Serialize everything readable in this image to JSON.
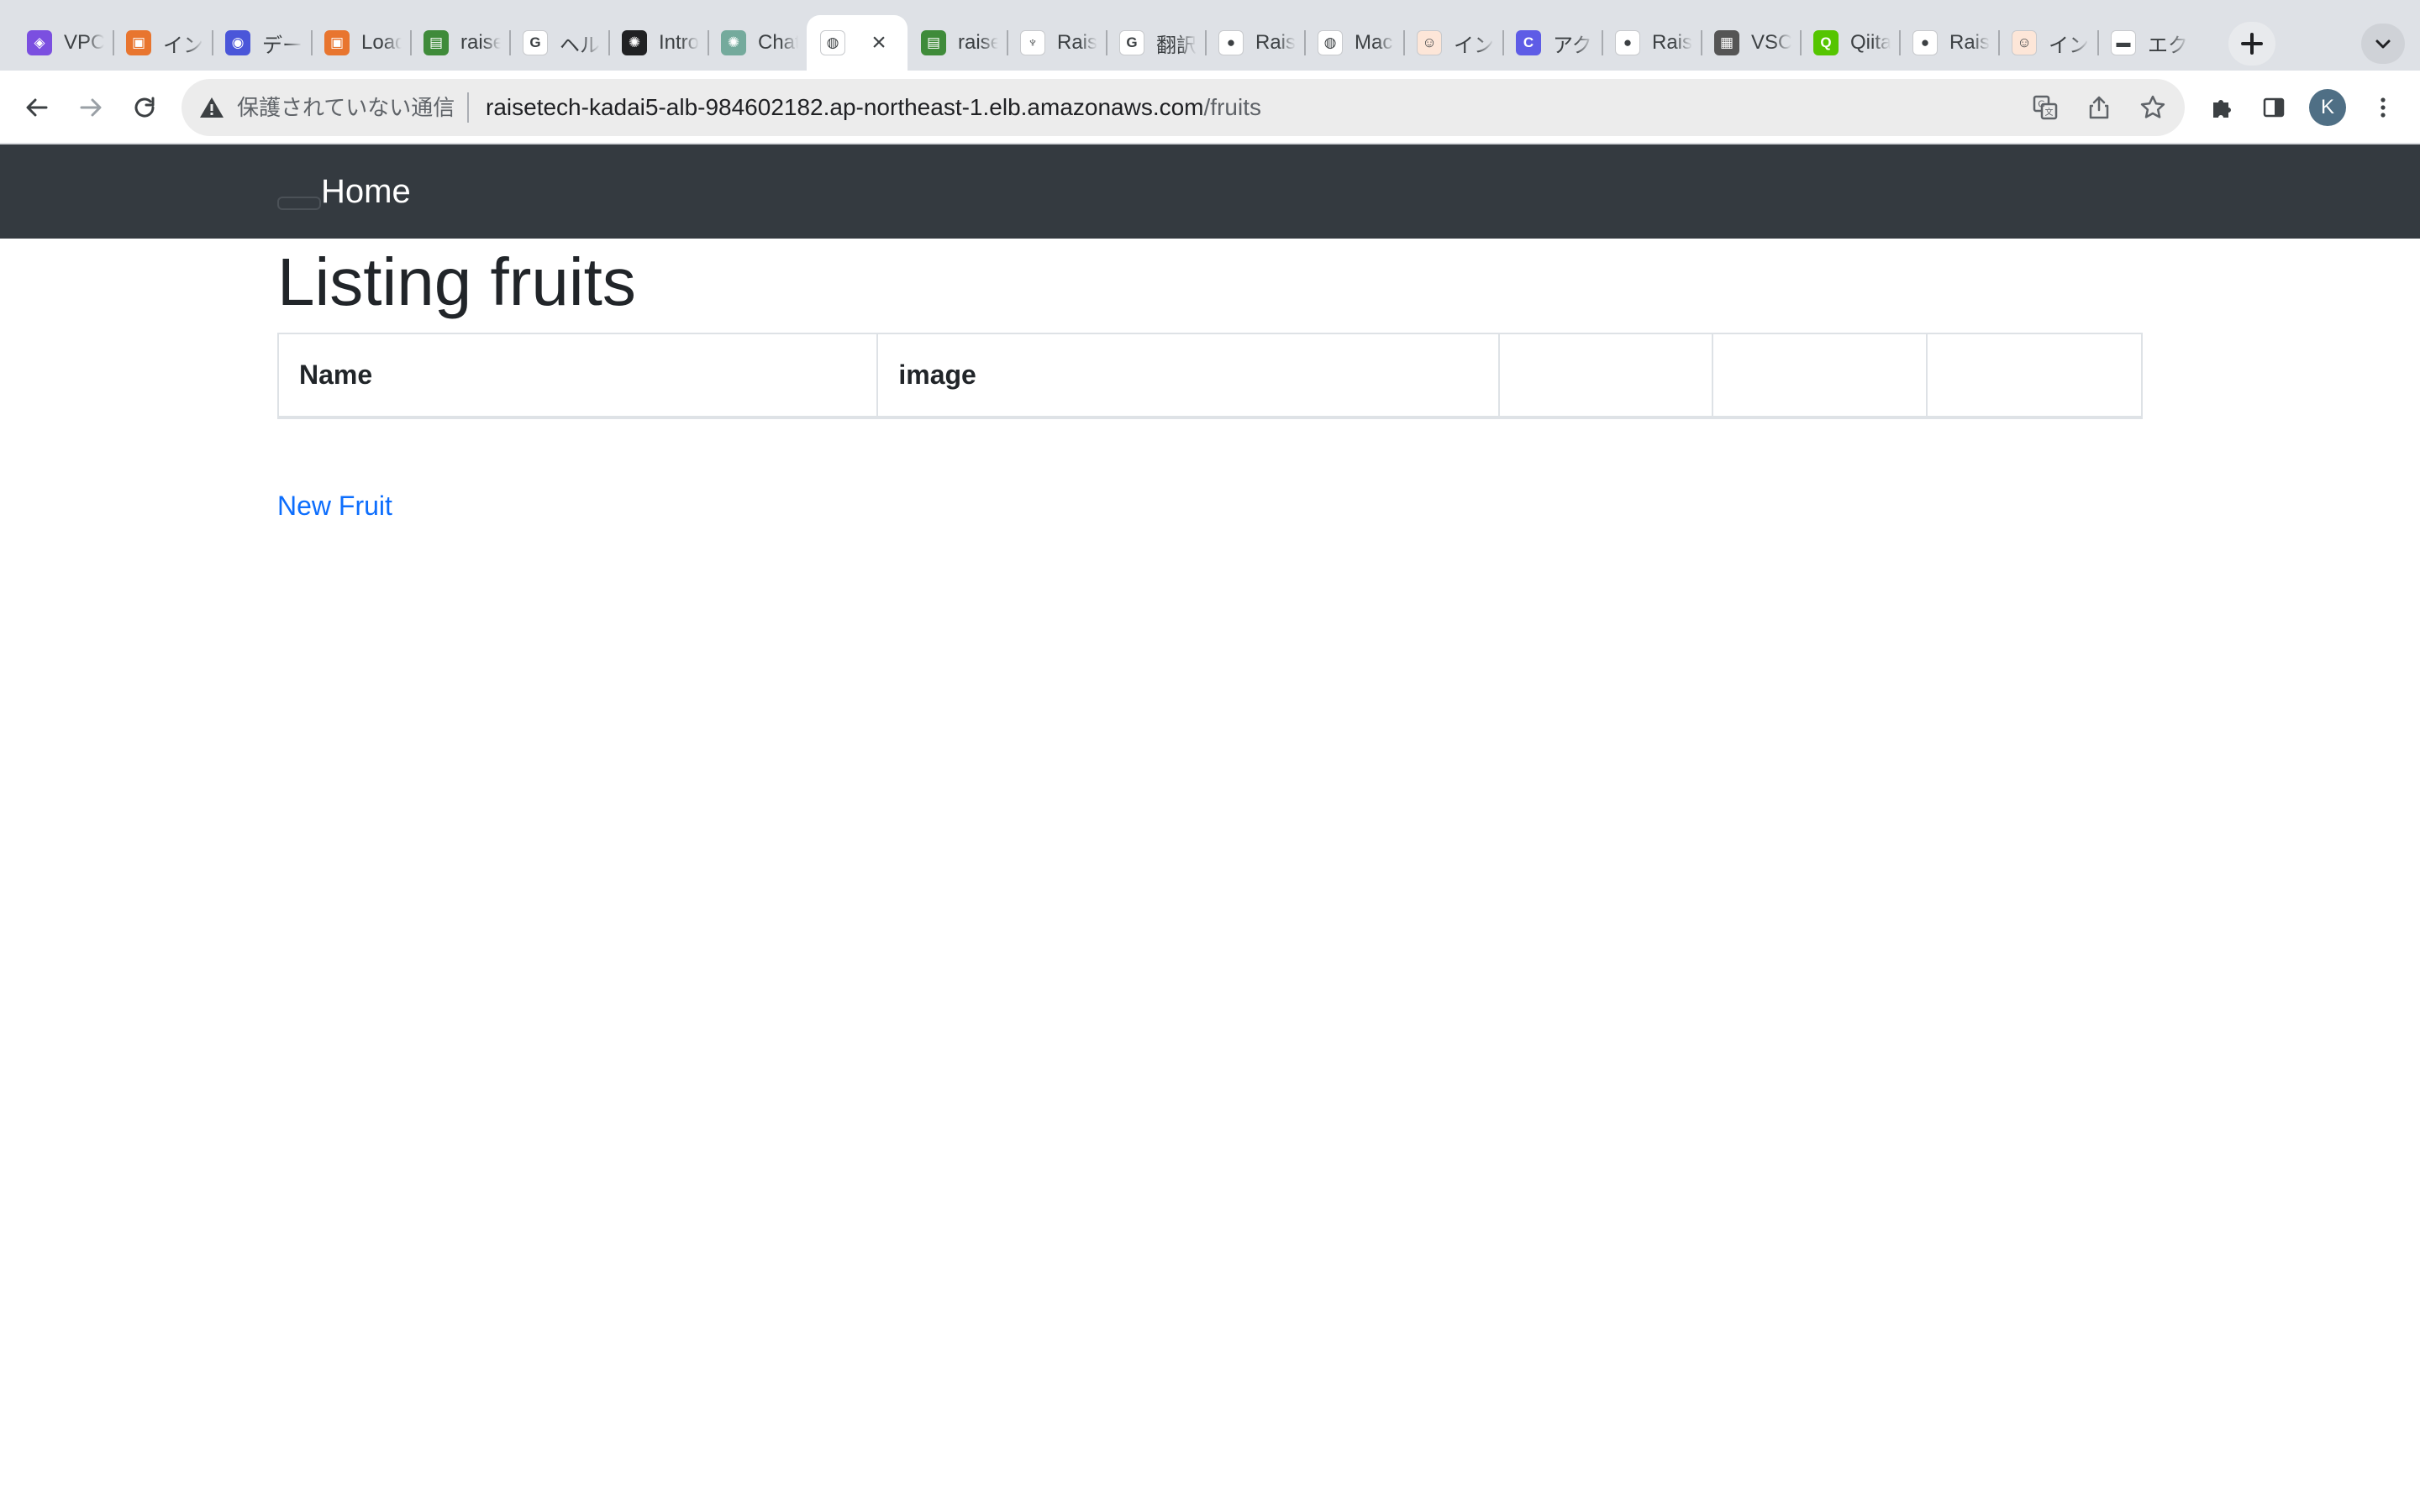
{
  "browser": {
    "tabs": [
      {
        "title": "VPC",
        "icon": "vpc-icon",
        "color": "#7b4fe0",
        "glyph": "◈"
      },
      {
        "title": "インスタンス",
        "icon": "ec2-icon",
        "color": "#e8752f",
        "glyph": "▣"
      },
      {
        "title": "データベース",
        "icon": "rds-icon",
        "color": "#4a56d9",
        "glyph": "◉"
      },
      {
        "title": "Load balancers",
        "icon": "ec2-icon",
        "color": "#e8752f",
        "glyph": "▣"
      },
      {
        "title": "raisetech",
        "icon": "s3-icon",
        "color": "#3f8b3a",
        "glyph": "▤"
      },
      {
        "title": "ヘルスチェック",
        "icon": "google-icon",
        "color": "#ffffff",
        "glyph": "G"
      },
      {
        "title": "Introducing",
        "icon": "openai-icon",
        "color": "#202123",
        "glyph": "✺"
      },
      {
        "title": "ChatGPT",
        "icon": "chatgpt-icon",
        "color": "#74aa9c",
        "glyph": "✺"
      },
      {
        "title": "",
        "icon": "globe-icon",
        "color": "#ffffff",
        "glyph": "◍",
        "active": true
      },
      {
        "title": "raisetech",
        "icon": "s3-icon",
        "color": "#3f8b3a",
        "glyph": "▤"
      },
      {
        "title": "RaiseTech",
        "icon": "raisetech-icon",
        "color": "#ffffff",
        "glyph": "♆"
      },
      {
        "title": "翻訳",
        "icon": "google-icon",
        "color": "#ffffff",
        "glyph": "G"
      },
      {
        "title": "RaiseTech",
        "icon": "github-icon",
        "color": "#ffffff",
        "glyph": "●"
      },
      {
        "title": "Mac",
        "icon": "globe-icon",
        "color": "#ffffff",
        "glyph": "◍"
      },
      {
        "title": "インフラ",
        "icon": "irasutoya-icon",
        "color": "#fde6d8",
        "glyph": "☺"
      },
      {
        "title": "アクセス",
        "icon": "c-icon",
        "color": "#5e5ce6",
        "glyph": "C"
      },
      {
        "title": "RaiseTech",
        "icon": "github-icon",
        "color": "#ffffff",
        "glyph": "●"
      },
      {
        "title": "VSCode",
        "icon": "vscode-icon",
        "color": "#555555",
        "glyph": "▦"
      },
      {
        "title": "Qiita",
        "icon": "qiita-icon",
        "color": "#55c500",
        "glyph": "Q"
      },
      {
        "title": "RaiseTech",
        "icon": "github-icon",
        "color": "#ffffff",
        "glyph": "●"
      },
      {
        "title": "インフラ",
        "icon": "irasutoya-icon",
        "color": "#fde6d8",
        "glyph": "☺"
      },
      {
        "title": "エクス",
        "icon": "page-icon",
        "color": "#ffffff",
        "glyph": "▬"
      }
    ],
    "security_label": "保護されていない通信",
    "url_host": "raisetech-kadai5-alb-984602182.ap-northeast-1.elb.amazonaws.com",
    "url_path": "/fruits",
    "profile_initial": "K"
  },
  "page": {
    "brand": "Home",
    "title": "Listing fruits",
    "columns": [
      "Name",
      "image",
      "",
      "",
      ""
    ],
    "new_link": "New Fruit",
    "link_color": "#0d6efd",
    "navbar_color": "#343a40"
  }
}
